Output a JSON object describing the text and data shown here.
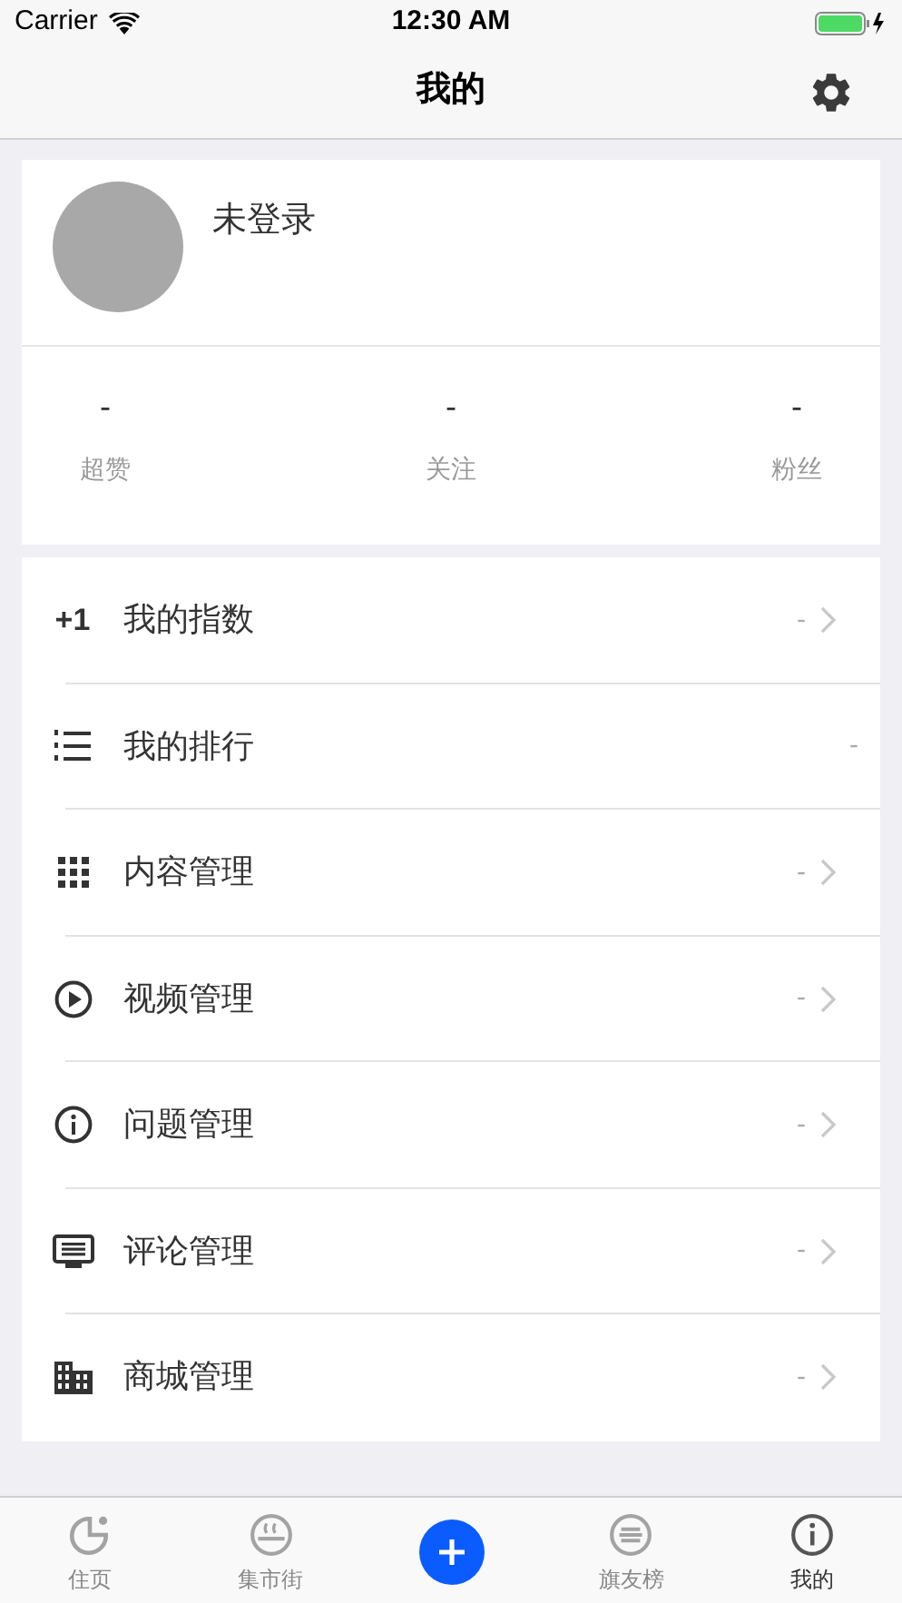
{
  "status_bar": {
    "carrier": "Carrier",
    "time": "12:30 AM"
  },
  "nav": {
    "title": "我的"
  },
  "profile": {
    "name": "未登录",
    "stats": [
      {
        "value": "-",
        "label": "超赞"
      },
      {
        "value": "-",
        "label": "关注"
      },
      {
        "value": "-",
        "label": "粉丝"
      }
    ]
  },
  "menu": [
    {
      "icon_text": "+1",
      "label": "我的指数",
      "value": "-",
      "arrow": true
    },
    {
      "label": "我的排行",
      "value": "-",
      "arrow": false
    },
    {
      "label": "内容管理",
      "value": "-",
      "arrow": true
    },
    {
      "label": "视频管理",
      "value": "-",
      "arrow": true
    },
    {
      "label": "问题管理",
      "value": "-",
      "arrow": true
    },
    {
      "label": "评论管理",
      "value": "-",
      "arrow": true
    },
    {
      "label": "商城管理",
      "value": "-",
      "arrow": true
    }
  ],
  "tabs": [
    {
      "kind": "tab",
      "label": "住页",
      "selected": false
    },
    {
      "kind": "tab",
      "label": "集市街",
      "selected": false
    },
    {
      "kind": "add"
    },
    {
      "kind": "tab",
      "label": "旗友榜",
      "selected": false
    },
    {
      "kind": "tab",
      "label": "我的",
      "selected": true
    }
  ]
}
